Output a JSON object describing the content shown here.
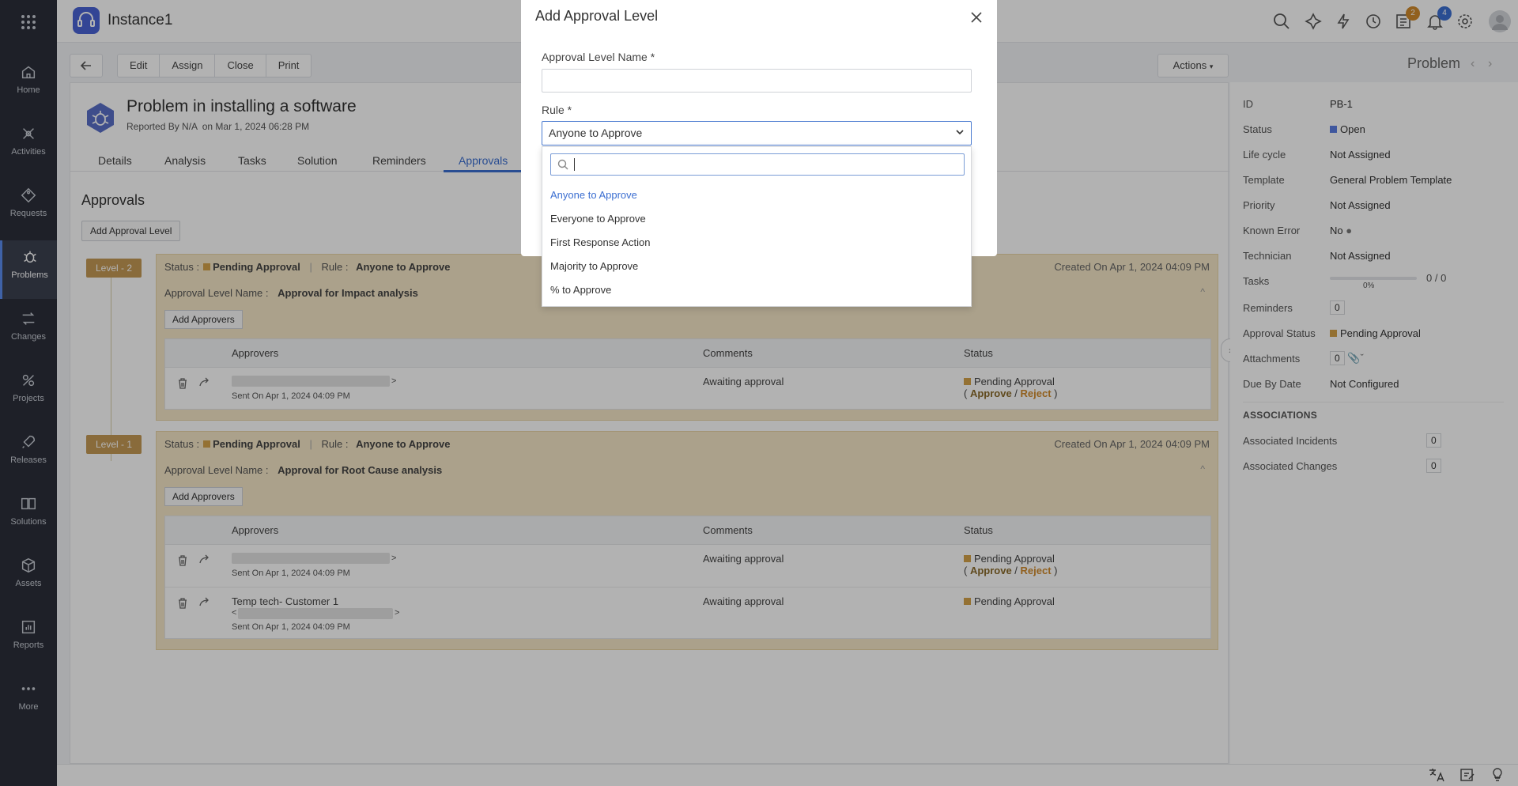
{
  "app": {
    "instance_name": "Instance1",
    "badge_tasks": "2",
    "badge_notifications": "4"
  },
  "nav": [
    {
      "label": "Home"
    },
    {
      "label": "Activities"
    },
    {
      "label": "Requests"
    },
    {
      "label": "Problems"
    },
    {
      "label": "Changes"
    },
    {
      "label": "Projects"
    },
    {
      "label": "Releases"
    },
    {
      "label": "Solutions"
    },
    {
      "label": "Assets"
    },
    {
      "label": "Reports"
    },
    {
      "label": "More"
    }
  ],
  "toolbar": {
    "edit": "Edit",
    "assign": "Assign",
    "close": "Close",
    "print": "Print",
    "actions": "Actions"
  },
  "right_header": "Problem",
  "problem": {
    "title": "Problem in installing a software",
    "reported_by_prefix": "Reported By",
    "reporter": "N/A",
    "reported_on": "on Mar 1, 2024 06:28 PM"
  },
  "tabs": [
    "Details",
    "Analysis",
    "Tasks",
    "Solution",
    "Reminders",
    "Approvals"
  ],
  "approvals": {
    "heading": "Approvals",
    "add_level_label": "Add Approval Level",
    "add_approvers_label": "Add Approvers",
    "col_approvers": "Approvers",
    "col_comments": "Comments",
    "col_status": "Status",
    "levels": [
      {
        "badge": "Level - 2",
        "status_label": "Status :",
        "status": "Pending Approval",
        "rule_label": "Rule :",
        "rule": "Anyone to Approve",
        "created": "Created On Apr 1, 2024 04:09 PM",
        "name_label": "Approval Level Name :",
        "name": "Approval for Impact analysis",
        "rows": [
          {
            "sent": "Sent On Apr 1, 2024 04:09 PM",
            "comment": "Awaiting approval",
            "status": "Pending Approval",
            "approve": "Approve",
            "reject": "Reject"
          }
        ]
      },
      {
        "badge": "Level - 1",
        "status_label": "Status :",
        "status": "Pending Approval",
        "rule_label": "Rule :",
        "rule": "Anyone to Approve",
        "created": "Created On Apr 1, 2024 04:09 PM",
        "name_label": "Approval Level Name :",
        "name": "Approval for Root Cause analysis",
        "rows": [
          {
            "sent": "Sent On Apr 1, 2024 04:09 PM",
            "comment": "Awaiting approval",
            "status": "Pending Approval",
            "approve": "Approve",
            "reject": "Reject"
          },
          {
            "name": "Temp tech- Customer 1",
            "sent": "Sent On Apr 1, 2024 04:09 PM",
            "comment": "Awaiting approval",
            "status": "Pending Approval"
          }
        ]
      }
    ]
  },
  "properties": [
    {
      "label": "ID",
      "value": "PB-1"
    },
    {
      "label": "Status",
      "value": "Open"
    },
    {
      "label": "Life cycle",
      "value": "Not Assigned"
    },
    {
      "label": "Template",
      "value": "General Problem Template"
    },
    {
      "label": "Priority",
      "value": "Not Assigned"
    },
    {
      "label": "Known Error",
      "value": "No"
    },
    {
      "label": "Technician",
      "value": "Not Assigned"
    },
    {
      "label": "Tasks",
      "value": "0 / 0",
      "percent": "0%"
    },
    {
      "label": "Reminders",
      "value": "0"
    },
    {
      "label": "Approval Status",
      "value": "Pending Approval"
    },
    {
      "label": "Attachments",
      "value": "0"
    },
    {
      "label": "Due By Date",
      "value": "Not Configured"
    }
  ],
  "associations": {
    "heading": "ASSOCIATIONS",
    "items": [
      {
        "label": "Associated Incidents",
        "value": "0"
      },
      {
        "label": "Associated Changes",
        "value": "0"
      }
    ]
  },
  "modal": {
    "title": "Add Approval Level",
    "name_label": "Approval Level Name *",
    "name_value": "",
    "rule_label": "Rule *",
    "rule_selected": "Anyone to Approve",
    "search_value": "",
    "options": [
      "Anyone to Approve",
      "Everyone to Approve",
      "First Response Action",
      "Majority to Approve",
      "% to Approve"
    ]
  },
  "colors": {
    "accent": "#3c6fd1",
    "pending": "#d4a24a",
    "open": "#5b7de3",
    "level_bg": "#f5e7c8",
    "rail": "#2b2f3a"
  }
}
